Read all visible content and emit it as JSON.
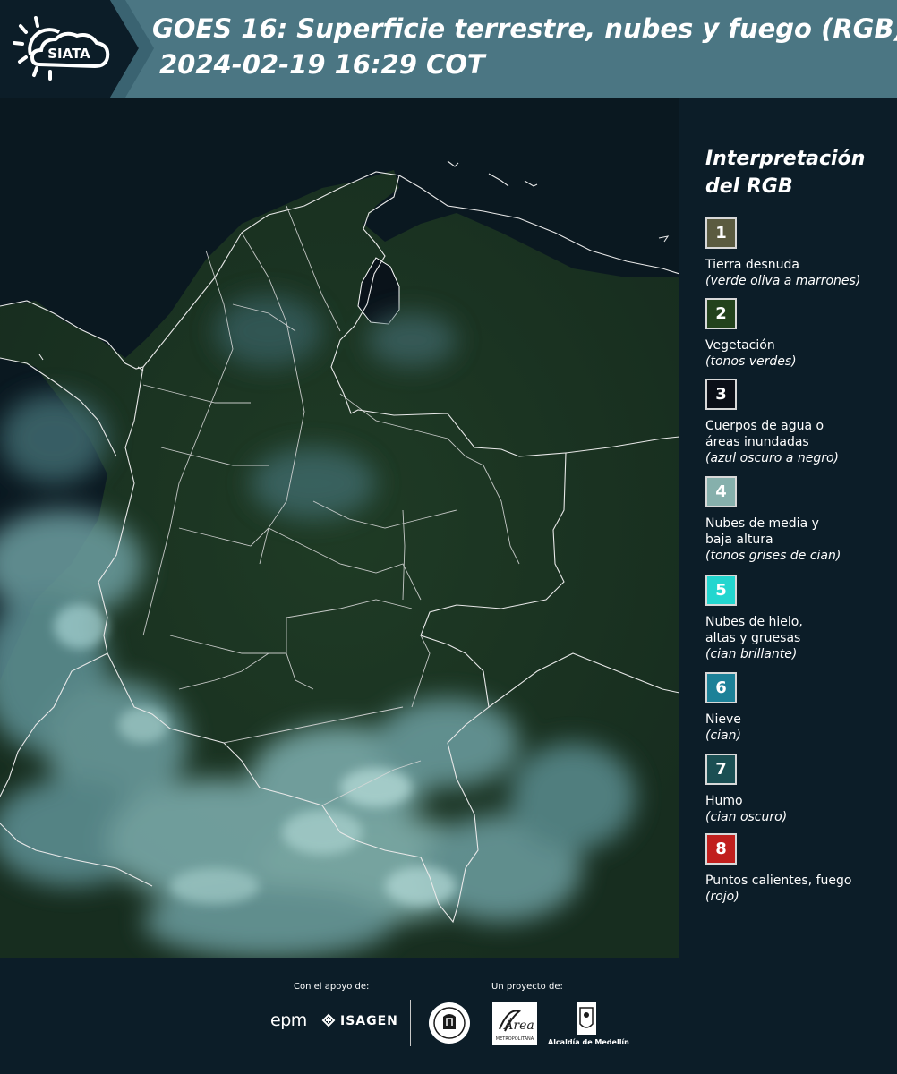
{
  "header": {
    "logo_text": "SIATA",
    "title": "GOES 16: Superficie terrestre, nubes y fuego (RGB)",
    "timestamp": "2024-02-19 16:29 COT",
    "colors": {
      "band_dark": "#0c1d28",
      "band_light": "#4b7683",
      "band_mid": "#3a6371"
    }
  },
  "map": {
    "image_type": "satellite-rgb-composite",
    "colors": {
      "land": "#1d3423",
      "ocean": "#0a1820",
      "cloud_low": "#6d9fa1",
      "cloud_high": "#a7d2cf",
      "border": "#e8e8e8"
    }
  },
  "legend": {
    "title": "Interpretación del RGB",
    "items": [
      {
        "number": "1",
        "name": "Tierra desnuda",
        "desc": "(verde oliva a marrones)",
        "color": "#5b5b40"
      },
      {
        "number": "2",
        "name": "Vegetación",
        "desc": "(tonos verdes)",
        "color": "#23421c"
      },
      {
        "number": "3",
        "name": "Cuerpos de agua o áreas inundadas",
        "desc": "(azul oscuro a negro)",
        "color": "#0b0f17"
      },
      {
        "number": "4",
        "name": "Nubes de media y baja altura",
        "desc": "(tonos grises de cian)",
        "color": "#86b0ac"
      },
      {
        "number": "5",
        "name": "Nubes de hielo, altas y gruesas",
        "desc": "(cian brillante)",
        "color": "#23d6cf"
      },
      {
        "number": "6",
        "name": "Nieve",
        "desc": "(cian)",
        "color": "#1d8198"
      },
      {
        "number": "7",
        "name": "Humo",
        "desc": "(cian oscuro)",
        "color": "#1b4f53"
      },
      {
        "number": "8",
        "name": "Puntos calientes, fuego",
        "desc": "(rojo)",
        "color": "#c11f1d"
      }
    ]
  },
  "footer": {
    "support_label": "Con el apoyo de:",
    "project_label": "Un proyecto de:",
    "sponsor_1": "epm",
    "sponsor_2": "ISAGEN",
    "partner_area": "Área",
    "partner_area_sub": "METROPOLITANA",
    "partner_alcaldia": "Alcaldía de Medellín"
  }
}
